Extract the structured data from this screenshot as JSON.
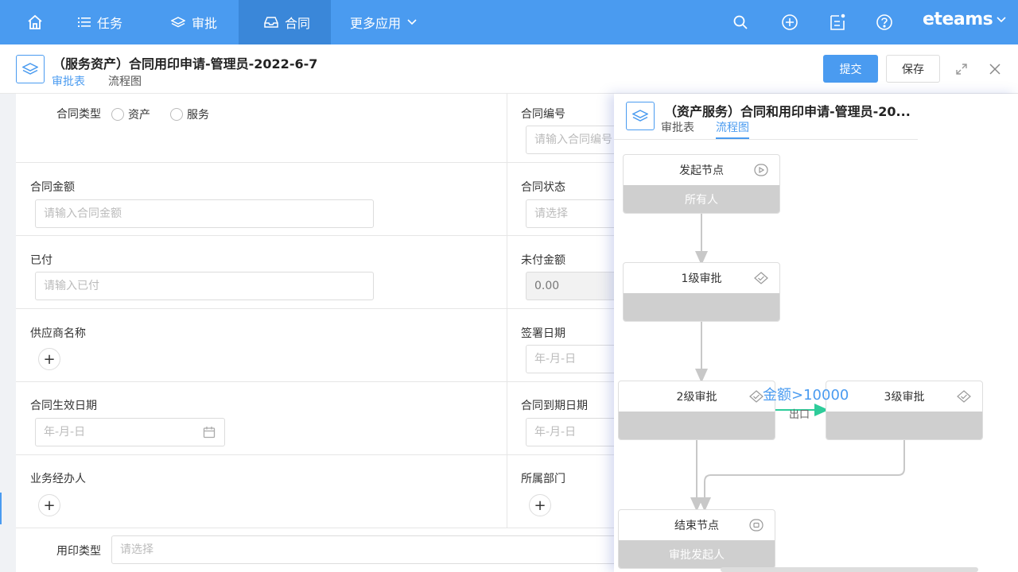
{
  "nav": {
    "items": [
      {
        "label": "任务"
      },
      {
        "label": "审批"
      },
      {
        "label": "合同"
      },
      {
        "label": "更多应用"
      }
    ],
    "brand": "eteams"
  },
  "header": {
    "title": "（服务资产）合同用印申请-管理员-2022-6-7",
    "tabs": [
      "审批表",
      "流程图"
    ],
    "submit_label": "提交",
    "save_label": "保存"
  },
  "form": {
    "contract_type": {
      "label": "合同类型",
      "options": [
        "资产",
        "服务"
      ]
    },
    "contract_no": {
      "label": "合同编号",
      "placeholder": "请输入合同编号"
    },
    "amount": {
      "label": "合同金额",
      "placeholder": "请输入合同金额"
    },
    "status": {
      "label": "合同状态",
      "placeholder": "请选择"
    },
    "paid": {
      "label": "已付",
      "placeholder": "请输入已付"
    },
    "unpaid": {
      "label": "未付金额",
      "value": "0.00"
    },
    "supplier": {
      "label": "供应商名称"
    },
    "sign_date": {
      "label": "签署日期",
      "placeholder": "年-月-日"
    },
    "effective_date": {
      "label": "合同生效日期",
      "placeholder": "年-月-日"
    },
    "expire_date": {
      "label": "合同到期日期",
      "placeholder": "年-月-日"
    },
    "handler": {
      "label": "业务经办人"
    },
    "department": {
      "label": "所属部门"
    },
    "seal_type": {
      "label": "用印类型",
      "placeholder": "请选择"
    }
  },
  "flow": {
    "title": "（资产服务）合同和用印申请-管理员-20...",
    "tabs": [
      "审批表",
      "流程图"
    ],
    "nodes": {
      "start": {
        "label": "发起节点",
        "assignee": "所有人"
      },
      "level1": {
        "label": "1级审批",
        "assignee": ""
      },
      "level2": {
        "label": "2级审批",
        "assignee": ""
      },
      "level3": {
        "label": "3级审批",
        "assignee": ""
      },
      "end": {
        "label": "结束节点",
        "assignee": "审批发起人"
      }
    },
    "condition": "金额>10000",
    "exit_label": "出口"
  },
  "colors": {
    "primary": "#4a9bf0",
    "nav_active": "#3a87d9",
    "flow_arrow": "#2ecc9a"
  }
}
